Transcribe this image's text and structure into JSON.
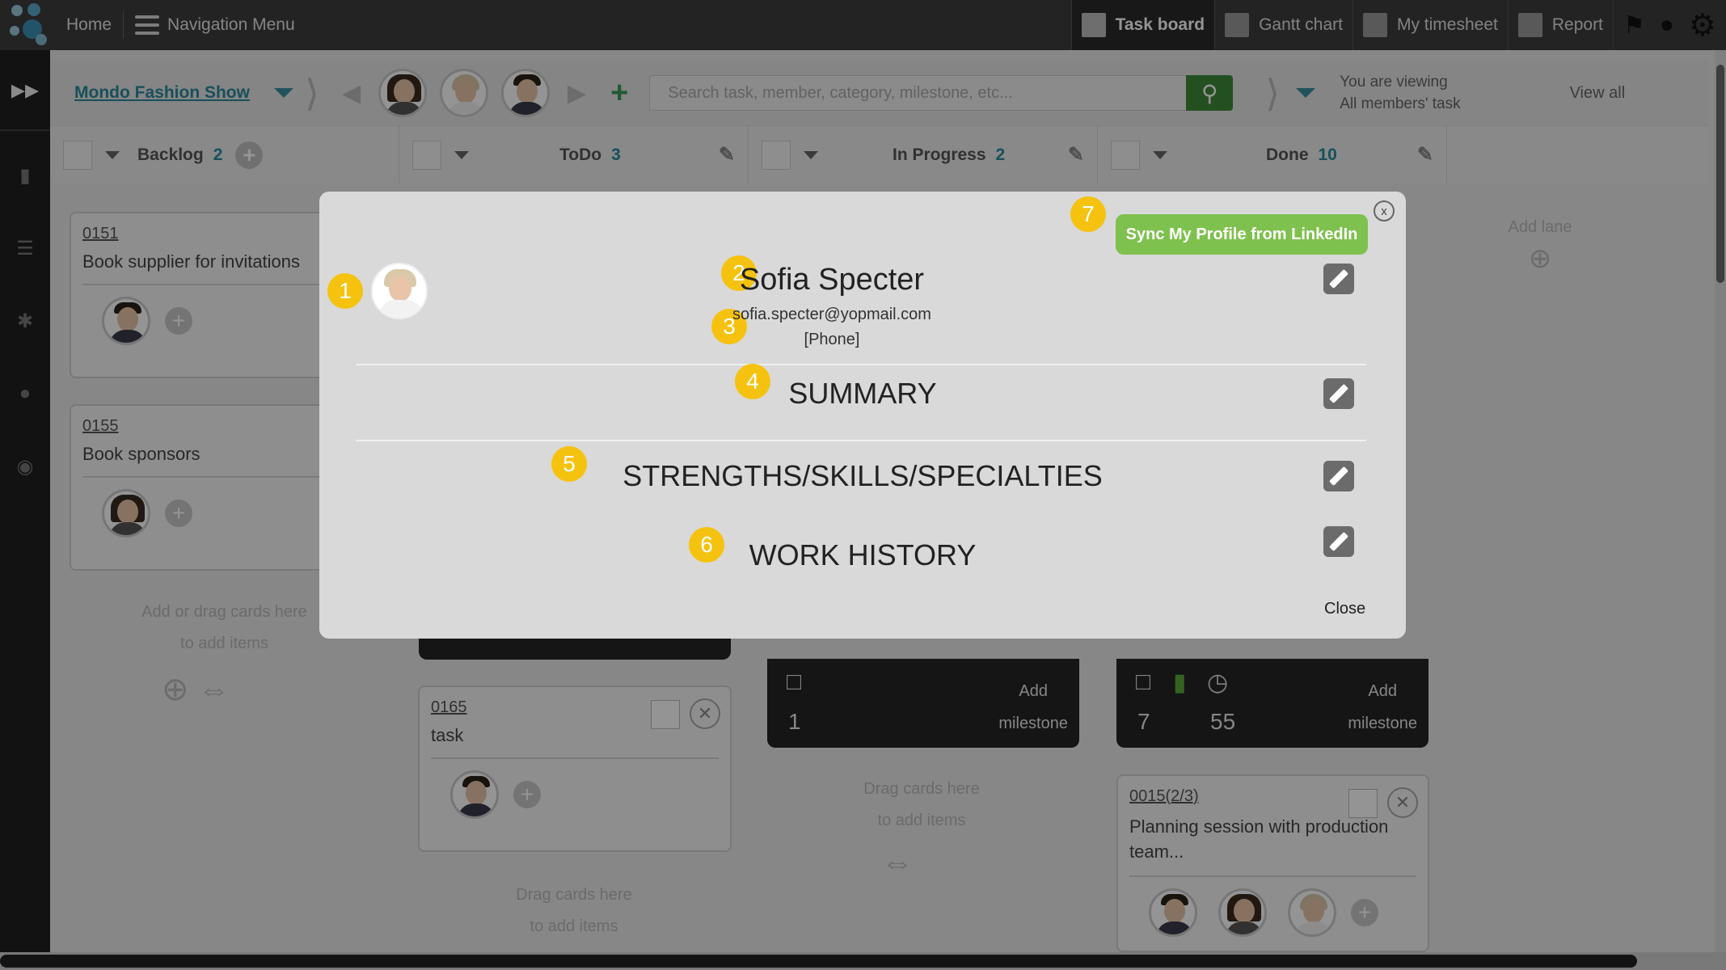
{
  "topbar": {
    "home_label": "Home",
    "nav_menu_label": "Navigation Menu",
    "views": [
      {
        "label": "Task board",
        "icon": "task-board-icon",
        "active": true
      },
      {
        "label": "Gantt chart",
        "icon": "gantt-chart-icon",
        "active": false
      },
      {
        "label": "My timesheet",
        "icon": "timesheet-icon",
        "active": false
      },
      {
        "label": "Report",
        "icon": "report-icon",
        "active": false
      }
    ]
  },
  "project": {
    "name": "Mondo Fashion Show",
    "search_placeholder": "Search task, member, category, milestone, etc...",
    "viewing_line1": "You are viewing",
    "viewing_line2": "All members' task",
    "view_all": "View all"
  },
  "lanes": [
    {
      "name": "Backlog",
      "count": "2"
    },
    {
      "name": "ToDo",
      "count": "3"
    },
    {
      "name": "In Progress",
      "count": "2"
    },
    {
      "name": "Done",
      "count": "10"
    }
  ],
  "add_lane": "Add lane",
  "cards": {
    "c151": {
      "id": "0151",
      "title": "Book supplier for invitations"
    },
    "c155": {
      "id": "0155",
      "title": "Book sponsors"
    },
    "c165": {
      "id": "0165",
      "title": "task"
    },
    "c15": {
      "id": "0015(2/3)",
      "title": "Planning session with production team..."
    }
  },
  "dark_cards": {
    "inprogress": {
      "comments": "1",
      "add_milestone_1": "Add",
      "add_milestone_2": "milestone"
    },
    "done": {
      "comments": "7",
      "time": "55",
      "add_milestone_1": "Add",
      "add_milestone_2": "milestone"
    }
  },
  "hints": {
    "backlog_1": "Add or drag cards here",
    "backlog_2": "to add items",
    "todo_1": "Drag cards here",
    "todo_2": "to add items",
    "inprog_1": "Drag cards here",
    "inprog_2": "to add items"
  },
  "modal": {
    "name": "Sofia Specter",
    "email": "sofia.specter@yopmail.com",
    "phone": "[Phone]",
    "sync_button": "Sync My Profile from LinkedIn",
    "summary": "SUMMARY",
    "strengths": "STRENGTHS/SKILLS/SPECIALTIES",
    "work_history": "WORK HISTORY",
    "close_label": "Close",
    "close_x": "x",
    "badges": [
      "1",
      "2",
      "3",
      "4",
      "5",
      "6",
      "7"
    ]
  },
  "colors": {
    "accent": "#2a8a9c",
    "sync_green": "#7ec14e",
    "badge_yellow": "#f5c20f",
    "topbar": "#3d3d3d"
  }
}
